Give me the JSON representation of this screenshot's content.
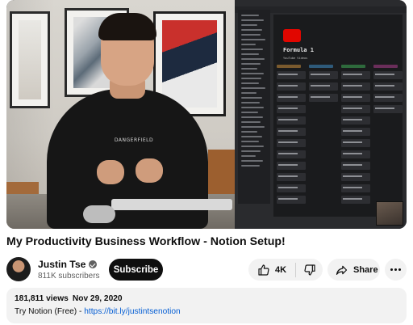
{
  "video": {
    "hoodie_text": "DANGERFIELD",
    "screen": {
      "page_title": "Formula 1",
      "subtitle": "YouTube Videos"
    },
    "accent_colors": {
      "f1_red": "#e10600",
      "notion_dark": "#1a1b1d"
    }
  },
  "title": "My Productivity Business Workflow - Notion Setup!",
  "channel": {
    "name": "Justin Tse",
    "subscribers": "811K subscribers",
    "verified_icon": "verified-check-icon"
  },
  "actions": {
    "subscribe_label": "Subscribe",
    "like_count": "4K",
    "share_label": "Share",
    "icons": [
      "thumbs-up-icon",
      "thumbs-down-icon",
      "share-arrow-icon",
      "more-horizontal-icon"
    ]
  },
  "description": {
    "views": "181,811 views",
    "date": "Nov 29, 2020",
    "text_prefix": "Try Notion (Free) - ",
    "link": "https://bit.ly/justintsenotion"
  }
}
